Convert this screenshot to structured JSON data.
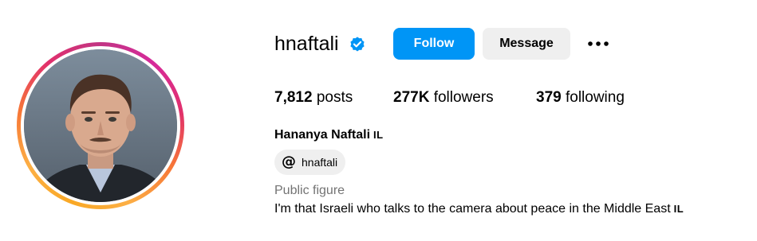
{
  "profile": {
    "username": "hnaftali",
    "verified_icon": "verified-badge-icon",
    "full_name": "Hananya Naftali",
    "name_flag": "IL",
    "category": "Public figure",
    "bio_text": "I'm that Israeli who talks to the camera about peace in the Middle East",
    "bio_flag": "IL",
    "threads_handle": "hnaftali",
    "threads_icon": "threads-icon"
  },
  "actions": {
    "follow_label": "Follow",
    "message_label": "Message",
    "more_icon": "more-options-icon"
  },
  "stats": {
    "posts_count": "7,812",
    "posts_label": "posts",
    "followers_count": "277K",
    "followers_label": "followers",
    "following_count": "379",
    "following_label": "following"
  },
  "colors": {
    "follow_bg": "#0095f6",
    "secondary_bg": "#efefef",
    "verified_blue": "#0095f6",
    "muted_text": "#737373"
  }
}
